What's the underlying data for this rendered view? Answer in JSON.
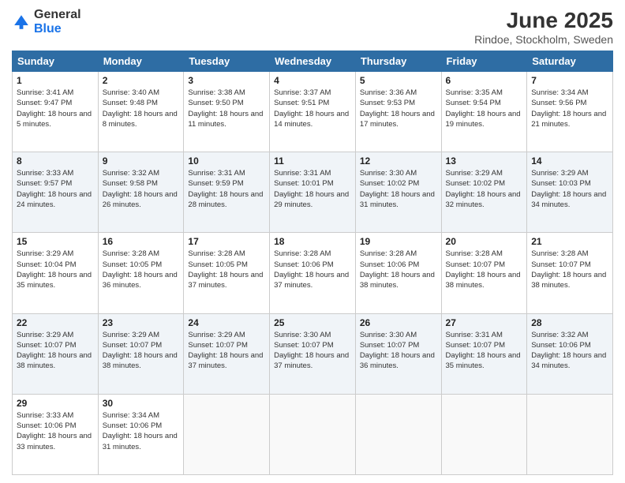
{
  "logo": {
    "general": "General",
    "blue": "Blue"
  },
  "title": "June 2025",
  "subtitle": "Rindoe, Stockholm, Sweden",
  "days_of_week": [
    "Sunday",
    "Monday",
    "Tuesday",
    "Wednesday",
    "Thursday",
    "Friday",
    "Saturday"
  ],
  "weeks": [
    [
      {
        "day": "1",
        "sunrise": "Sunrise: 3:41 AM",
        "sunset": "Sunset: 9:47 PM",
        "daylight": "Daylight: 18 hours and 5 minutes."
      },
      {
        "day": "2",
        "sunrise": "Sunrise: 3:40 AM",
        "sunset": "Sunset: 9:48 PM",
        "daylight": "Daylight: 18 hours and 8 minutes."
      },
      {
        "day": "3",
        "sunrise": "Sunrise: 3:38 AM",
        "sunset": "Sunset: 9:50 PM",
        "daylight": "Daylight: 18 hours and 11 minutes."
      },
      {
        "day": "4",
        "sunrise": "Sunrise: 3:37 AM",
        "sunset": "Sunset: 9:51 PM",
        "daylight": "Daylight: 18 hours and 14 minutes."
      },
      {
        "day": "5",
        "sunrise": "Sunrise: 3:36 AM",
        "sunset": "Sunset: 9:53 PM",
        "daylight": "Daylight: 18 hours and 17 minutes."
      },
      {
        "day": "6",
        "sunrise": "Sunrise: 3:35 AM",
        "sunset": "Sunset: 9:54 PM",
        "daylight": "Daylight: 18 hours and 19 minutes."
      },
      {
        "day": "7",
        "sunrise": "Sunrise: 3:34 AM",
        "sunset": "Sunset: 9:56 PM",
        "daylight": "Daylight: 18 hours and 21 minutes."
      }
    ],
    [
      {
        "day": "8",
        "sunrise": "Sunrise: 3:33 AM",
        "sunset": "Sunset: 9:57 PM",
        "daylight": "Daylight: 18 hours and 24 minutes."
      },
      {
        "day": "9",
        "sunrise": "Sunrise: 3:32 AM",
        "sunset": "Sunset: 9:58 PM",
        "daylight": "Daylight: 18 hours and 26 minutes."
      },
      {
        "day": "10",
        "sunrise": "Sunrise: 3:31 AM",
        "sunset": "Sunset: 9:59 PM",
        "daylight": "Daylight: 18 hours and 28 minutes."
      },
      {
        "day": "11",
        "sunrise": "Sunrise: 3:31 AM",
        "sunset": "Sunset: 10:01 PM",
        "daylight": "Daylight: 18 hours and 29 minutes."
      },
      {
        "day": "12",
        "sunrise": "Sunrise: 3:30 AM",
        "sunset": "Sunset: 10:02 PM",
        "daylight": "Daylight: 18 hours and 31 minutes."
      },
      {
        "day": "13",
        "sunrise": "Sunrise: 3:29 AM",
        "sunset": "Sunset: 10:02 PM",
        "daylight": "Daylight: 18 hours and 32 minutes."
      },
      {
        "day": "14",
        "sunrise": "Sunrise: 3:29 AM",
        "sunset": "Sunset: 10:03 PM",
        "daylight": "Daylight: 18 hours and 34 minutes."
      }
    ],
    [
      {
        "day": "15",
        "sunrise": "Sunrise: 3:29 AM",
        "sunset": "Sunset: 10:04 PM",
        "daylight": "Daylight: 18 hours and 35 minutes."
      },
      {
        "day": "16",
        "sunrise": "Sunrise: 3:28 AM",
        "sunset": "Sunset: 10:05 PM",
        "daylight": "Daylight: 18 hours and 36 minutes."
      },
      {
        "day": "17",
        "sunrise": "Sunrise: 3:28 AM",
        "sunset": "Sunset: 10:05 PM",
        "daylight": "Daylight: 18 hours and 37 minutes."
      },
      {
        "day": "18",
        "sunrise": "Sunrise: 3:28 AM",
        "sunset": "Sunset: 10:06 PM",
        "daylight": "Daylight: 18 hours and 37 minutes."
      },
      {
        "day": "19",
        "sunrise": "Sunrise: 3:28 AM",
        "sunset": "Sunset: 10:06 PM",
        "daylight": "Daylight: 18 hours and 38 minutes."
      },
      {
        "day": "20",
        "sunrise": "Sunrise: 3:28 AM",
        "sunset": "Sunset: 10:07 PM",
        "daylight": "Daylight: 18 hours and 38 minutes."
      },
      {
        "day": "21",
        "sunrise": "Sunrise: 3:28 AM",
        "sunset": "Sunset: 10:07 PM",
        "daylight": "Daylight: 18 hours and 38 minutes."
      }
    ],
    [
      {
        "day": "22",
        "sunrise": "Sunrise: 3:29 AM",
        "sunset": "Sunset: 10:07 PM",
        "daylight": "Daylight: 18 hours and 38 minutes."
      },
      {
        "day": "23",
        "sunrise": "Sunrise: 3:29 AM",
        "sunset": "Sunset: 10:07 PM",
        "daylight": "Daylight: 18 hours and 38 minutes."
      },
      {
        "day": "24",
        "sunrise": "Sunrise: 3:29 AM",
        "sunset": "Sunset: 10:07 PM",
        "daylight": "Daylight: 18 hours and 37 minutes."
      },
      {
        "day": "25",
        "sunrise": "Sunrise: 3:30 AM",
        "sunset": "Sunset: 10:07 PM",
        "daylight": "Daylight: 18 hours and 37 minutes."
      },
      {
        "day": "26",
        "sunrise": "Sunrise: 3:30 AM",
        "sunset": "Sunset: 10:07 PM",
        "daylight": "Daylight: 18 hours and 36 minutes."
      },
      {
        "day": "27",
        "sunrise": "Sunrise: 3:31 AM",
        "sunset": "Sunset: 10:07 PM",
        "daylight": "Daylight: 18 hours and 35 minutes."
      },
      {
        "day": "28",
        "sunrise": "Sunrise: 3:32 AM",
        "sunset": "Sunset: 10:06 PM",
        "daylight": "Daylight: 18 hours and 34 minutes."
      }
    ],
    [
      {
        "day": "29",
        "sunrise": "Sunrise: 3:33 AM",
        "sunset": "Sunset: 10:06 PM",
        "daylight": "Daylight: 18 hours and 33 minutes."
      },
      {
        "day": "30",
        "sunrise": "Sunrise: 3:34 AM",
        "sunset": "Sunset: 10:06 PM",
        "daylight": "Daylight: 18 hours and 31 minutes."
      },
      {
        "day": "",
        "sunrise": "",
        "sunset": "",
        "daylight": ""
      },
      {
        "day": "",
        "sunrise": "",
        "sunset": "",
        "daylight": ""
      },
      {
        "day": "",
        "sunrise": "",
        "sunset": "",
        "daylight": ""
      },
      {
        "day": "",
        "sunrise": "",
        "sunset": "",
        "daylight": ""
      },
      {
        "day": "",
        "sunrise": "",
        "sunset": "",
        "daylight": ""
      }
    ]
  ]
}
